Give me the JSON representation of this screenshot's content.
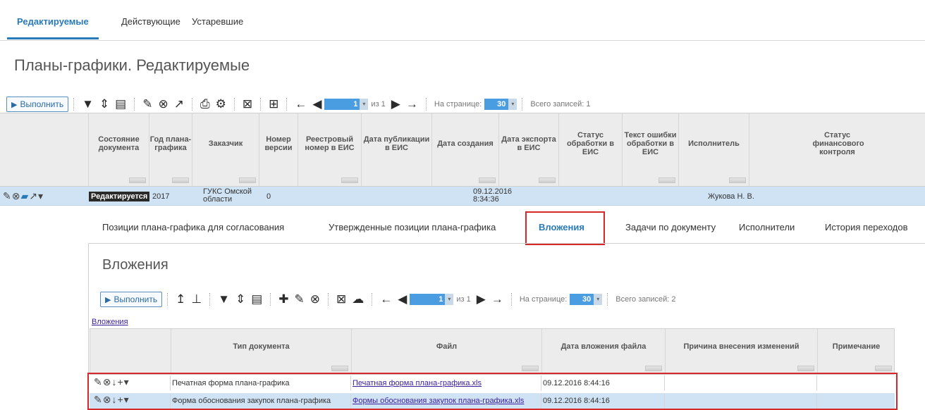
{
  "top_tabs": [
    "Редактируемые",
    "Действующие",
    "Устаревшие"
  ],
  "page_title": "Планы-графики. Редактируемые",
  "toolbar": {
    "run_label": "Выполнить",
    "page_current": "1",
    "page_of": "из 1",
    "per_page_label": "На странице:",
    "per_page_value": "30",
    "total_label": "Всего записей: 1"
  },
  "grid": {
    "columns": [
      "Состояние документа",
      "Год плана-графика",
      "Заказчик",
      "Номер версии",
      "Реестровый номер в ЕИС",
      "Дата публикации в ЕИС",
      "Дата создания",
      "Дата экспорта в ЕИС",
      "Статус обработки в ЕИС",
      "Текст ошибки обработки в ЕИС",
      "Исполнитель",
      "Статус финансового контроля"
    ],
    "row": {
      "status": "Редактируется",
      "year": "2017",
      "customer": "ГУКС Омской области",
      "version": "0",
      "created_date": "09.12.2016",
      "created_time": "8:34:36",
      "executor": "Жукова Н. В."
    }
  },
  "sub_tabs": [
    "Позиции плана-графика для согласования",
    "Утвержденные позиции плана-графика",
    "Вложения",
    "Задачи по документу",
    "Исполнители",
    "История переходов"
  ],
  "attachments": {
    "title": "Вложения",
    "toolbar": {
      "run_label": "Выполнить",
      "page_current": "1",
      "page_of": "из 1",
      "per_page_label": "На странице:",
      "per_page_value": "30",
      "total_label": "Всего записей: 2"
    },
    "link_label": "Вложения",
    "columns": [
      "Тип документа",
      "Файл",
      "Дата вложения файла",
      "Причина внесения изменений",
      "Примечание"
    ],
    "rows": [
      {
        "type": "Печатная форма плана-графика",
        "file": "Печатная форма плана-графика.xls",
        "date": "09.12.2016 8:44:16"
      },
      {
        "type": "Форма обоснования закупок плана-графика",
        "file": "Формы обоснования закупок плана-графика.xls",
        "date": "09.12.2016 8:44:16"
      }
    ]
  },
  "colors": {
    "accent": "#2a7ab8",
    "selected_row": "#cfe3f5",
    "highlight": "#d62828"
  }
}
